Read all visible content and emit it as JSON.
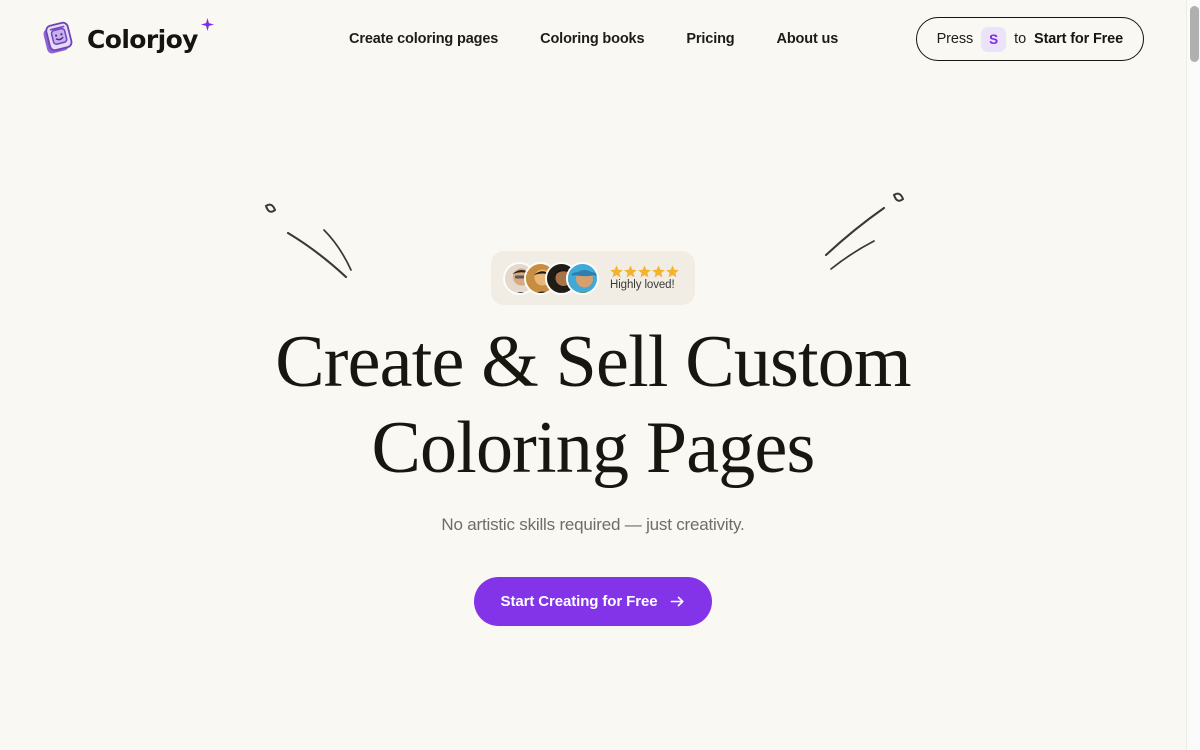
{
  "brand": {
    "name": "Colorjoy",
    "mark_icon": "coloring-book-logo-icon",
    "sparkle_icon": "sparkle-icon",
    "mark_color": "#a06fe0",
    "sparkle_color": "#7c2ae8"
  },
  "nav": {
    "items": [
      {
        "label": "Create coloring pages"
      },
      {
        "label": "Coloring books"
      },
      {
        "label": "Pricing"
      },
      {
        "label": "About us"
      }
    ]
  },
  "header_cta": {
    "prefix": "Press",
    "key": "S",
    "middle": "to",
    "action": "Start for Free",
    "key_bg": "#ece3fb",
    "key_color": "#7c2ae8"
  },
  "hero": {
    "social_proof": {
      "avatar_count": 4,
      "stars": 5,
      "star_color": "#f5b22d",
      "caption": "Highly loved!"
    },
    "headline_line1": "Create & Sell Custom",
    "headline_line2": "Coloring Pages",
    "subtitle": "No artistic skills required — just creativity.",
    "cta": {
      "label": "Start Creating for Free",
      "icon": "arrow-right-icon",
      "bg": "#8333e8",
      "color": "#ffffff"
    }
  },
  "decor": {
    "left_doodle": "sparkle-motion-lines-icon",
    "right_doodle": "sparkle-motion-lines-icon",
    "stroke": "#3a382f"
  },
  "colors": {
    "page_bg": "#faf8f3",
    "pill_bg": "#f1ede5",
    "text": "#17160f",
    "muted": "#6f6d67"
  },
  "scrollbar": {
    "position": "right",
    "thumb_color": "#b0b0b0"
  }
}
